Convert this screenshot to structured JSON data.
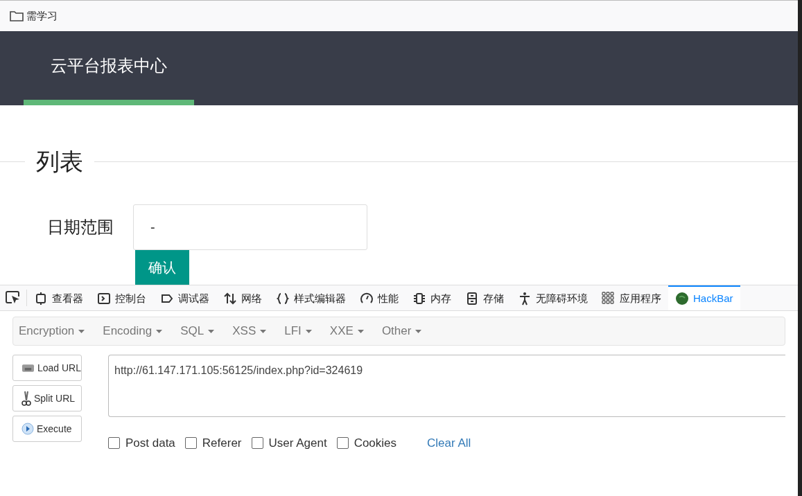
{
  "bookmarks_bar": {
    "folder": "需学习"
  },
  "header": {
    "title": "云平台报表中心",
    "selected": true
  },
  "section": {
    "legend": "列表",
    "date_range": {
      "label": "日期范围",
      "value": "-"
    },
    "confirm_button": "确认"
  },
  "devtools_tabs": [
    {
      "kind": "inspector",
      "label": "查看器",
      "selected": false
    },
    {
      "kind": "console",
      "label": "控制台",
      "selected": false
    },
    {
      "kind": "debugger",
      "label": "调试器",
      "selected": false
    },
    {
      "kind": "network",
      "label": "网络",
      "selected": false
    },
    {
      "kind": "style",
      "label": "样式编辑器",
      "selected": false
    },
    {
      "kind": "performance",
      "label": "性能",
      "selected": false
    },
    {
      "kind": "memory",
      "label": "内存",
      "selected": false
    },
    {
      "kind": "storage",
      "label": "存储",
      "selected": false
    },
    {
      "kind": "accessibility",
      "label": "无障碍环境",
      "selected": false
    },
    {
      "kind": "apps",
      "label": "应用程序",
      "selected": false
    },
    {
      "kind": "hackbar",
      "label": "HackBar",
      "selected": true
    }
  ],
  "hackbar": {
    "menus": [
      "Encryption",
      "Encoding",
      "SQL",
      "XSS",
      "LFI",
      "XXE",
      "Other"
    ],
    "actions": [
      {
        "kind": "load",
        "label": "Load URL"
      },
      {
        "kind": "split",
        "label": "Split URL"
      },
      {
        "kind": "execute",
        "label": "Execute"
      }
    ],
    "url": "http://61.147.171.105:56125/index.php?id=324619",
    "options": [
      {
        "label": "Post data",
        "checked": false
      },
      {
        "label": "Referer",
        "checked": false
      },
      {
        "label": "User Agent",
        "checked": false
      },
      {
        "label": "Cookies",
        "checked": false
      }
    ],
    "clear_all": "Clear All"
  }
}
